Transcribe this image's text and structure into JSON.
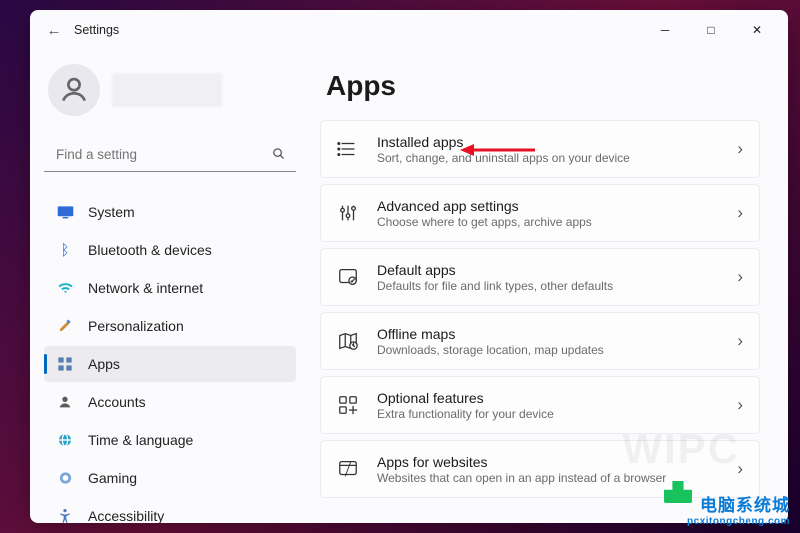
{
  "window": {
    "title": "Settings"
  },
  "search": {
    "placeholder": "Find a setting"
  },
  "sidebar": {
    "items": [
      {
        "label": "System"
      },
      {
        "label": "Bluetooth & devices"
      },
      {
        "label": "Network & internet"
      },
      {
        "label": "Personalization"
      },
      {
        "label": "Apps"
      },
      {
        "label": "Accounts"
      },
      {
        "label": "Time & language"
      },
      {
        "label": "Gaming"
      },
      {
        "label": "Accessibility"
      }
    ]
  },
  "page": {
    "heading": "Apps"
  },
  "cards": [
    {
      "title": "Installed apps",
      "sub": "Sort, change, and uninstall apps on your device"
    },
    {
      "title": "Advanced app settings",
      "sub": "Choose where to get apps, archive apps"
    },
    {
      "title": "Default apps",
      "sub": "Defaults for file and link types, other defaults"
    },
    {
      "title": "Offline maps",
      "sub": "Downloads, storage location, map updates"
    },
    {
      "title": "Optional features",
      "sub": "Extra functionality for your device"
    },
    {
      "title": "Apps for websites",
      "sub": "Websites that can open in an app instead of a browser"
    }
  ],
  "watermark": {
    "cn": "电脑系统城",
    "url": "pcxitongcheng.com",
    "faint": "WIPC"
  }
}
